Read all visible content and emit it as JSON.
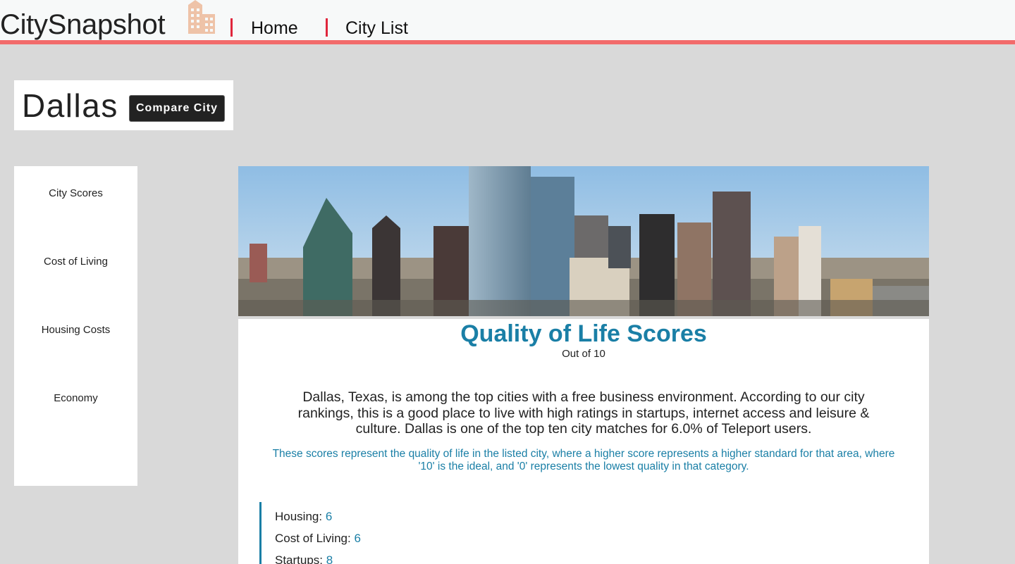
{
  "nav": {
    "brand": "CitySnapshot",
    "brand_icon": "building-icon",
    "links": [
      "Home",
      "City List"
    ],
    "accent_color": "#f26b6b",
    "separator_color": "#e0263c"
  },
  "city": {
    "name": "Dallas",
    "compare_label": "Compare City"
  },
  "sidebar": {
    "items": [
      "City Scores",
      "Cost of Living",
      "Housing Costs",
      "Economy"
    ]
  },
  "main": {
    "hero_image": "dallas-skyline-photo",
    "title": "Quality of Life Scores",
    "subtitle": "Out of 10",
    "summary": "Dallas, Texas, is among the top cities with a free business environment. According to our city rankings, this is a good place to live with high ratings in startups, internet access and leisure & culture. Dallas is one of the top ten city matches for 6.0% of Teleport users.",
    "note": "These scores represent the quality of life in the listed city, where a higher score represents a higher standard for that area, where '10' is the ideal, and '0' represents the lowest quality in that category.",
    "accent_color": "#1a7fa6",
    "scores": [
      {
        "label": "Housing:",
        "value": "6"
      },
      {
        "label": "Cost of Living:",
        "value": "6"
      },
      {
        "label": "Startups:",
        "value": "8"
      }
    ]
  }
}
